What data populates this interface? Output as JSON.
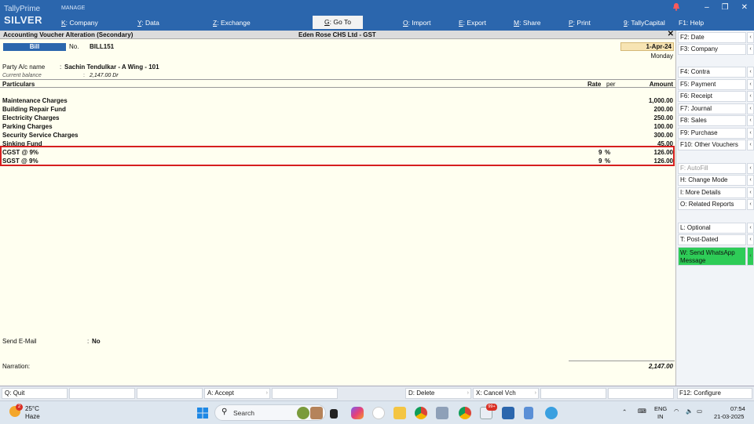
{
  "app": {
    "brand_line1": "TallyPrime",
    "brand_line2": "SILVER",
    "manage_label": "MANAGE"
  },
  "top_menu": [
    {
      "key": "K",
      "label": "Company"
    },
    {
      "key": "Y",
      "label": "Data"
    },
    {
      "key": "Z",
      "label": "Exchange"
    },
    {
      "key": "G",
      "label": "Go To"
    },
    {
      "key": "O",
      "label": "Import"
    },
    {
      "key": "E",
      "label": "Export"
    },
    {
      "key": "M",
      "label": "Share"
    },
    {
      "key": "P",
      "label": "Print"
    },
    {
      "key": "9",
      "label": "TallyCapital"
    },
    {
      "key": "F1",
      "label": "Help"
    }
  ],
  "title_bar": {
    "left": "Accounting Voucher Alteration (Secondary)",
    "center": "Eden Rose CHS Ltd - GST",
    "close_glyph": "✕"
  },
  "voucher": {
    "type_badge": "Bill",
    "no_label": "No.",
    "no_value": "BILL151",
    "date": "1-Apr-24",
    "day": "Monday",
    "party_label": "Party A/c name",
    "party_colon": ":",
    "party_value": "Sachin Tendulkar - A Wing - 101",
    "balance_label": "Current balance",
    "balance_colon": ":",
    "balance_value": "2,147.00 Dr"
  },
  "columns": {
    "particulars": "Particulars",
    "rate": "Rate",
    "per": "per",
    "amount": "Amount"
  },
  "entries": [
    {
      "name": "Maintenance Charges",
      "rate": "",
      "per": "",
      "amount": "1,000.00"
    },
    {
      "name": "Building Repair Fund",
      "rate": "",
      "per": "",
      "amount": "200.00"
    },
    {
      "name": "Electricity Charges",
      "rate": "",
      "per": "",
      "amount": "250.00"
    },
    {
      "name": "Parking Charges",
      "rate": "",
      "per": "",
      "amount": "100.00"
    },
    {
      "name": "Security Service Charges",
      "rate": "",
      "per": "",
      "amount": "300.00"
    },
    {
      "name": "Sinking Fund",
      "rate": "",
      "per": "",
      "amount": "45.00"
    },
    {
      "name": "CGST @ 9%",
      "rate": "9",
      "per": "%",
      "amount": "126.00"
    },
    {
      "name": "SGST @ 9%",
      "rate": "9",
      "per": "%",
      "amount": "126.00"
    }
  ],
  "footer": {
    "email_label": "Send E-Mail",
    "email_colon": ":",
    "email_value": "No",
    "narration_label": "Narration:",
    "total": "2,147.00"
  },
  "right_panel": [
    {
      "key": "F2",
      "label": "Date",
      "state": "enabled"
    },
    {
      "key": "F3",
      "label": "Company",
      "state": "enabled"
    },
    {
      "key": "F4",
      "label": "Contra",
      "state": "enabled"
    },
    {
      "key": "F5",
      "label": "Payment",
      "state": "enabled"
    },
    {
      "key": "F6",
      "label": "Receipt",
      "state": "enabled"
    },
    {
      "key": "F7",
      "label": "Journal",
      "state": "enabled"
    },
    {
      "key": "F8",
      "label": "Sales",
      "state": "enabled"
    },
    {
      "key": "F9",
      "label": "Purchase",
      "state": "enabled"
    },
    {
      "key": "F10",
      "label": "Other Vouchers",
      "state": "enabled"
    },
    {
      "key": "F",
      "label": "AutoFill",
      "state": "disabled"
    },
    {
      "key": "H",
      "label": "Change Mode",
      "state": "enabled"
    },
    {
      "key": "I",
      "label": "More Details",
      "state": "enabled"
    },
    {
      "key": "O",
      "label": "Related Reports",
      "state": "enabled"
    },
    {
      "key": "L",
      "label": "Optional",
      "state": "enabled"
    },
    {
      "key": "T",
      "label": "Post-Dated",
      "state": "enabled"
    },
    {
      "key": "W",
      "label": "Send WhatsApp Message",
      "state": "highlight"
    }
  ],
  "bottom_bar": [
    {
      "key": "Q",
      "label": "Quit"
    },
    {
      "key": "",
      "label": ""
    },
    {
      "key": "",
      "label": ""
    },
    {
      "key": "A",
      "label": "Accept"
    },
    {
      "key": "",
      "label": ""
    },
    {
      "key": "D",
      "label": "Delete"
    },
    {
      "key": "X",
      "label": "Cancel Vch"
    },
    {
      "key": "",
      "label": ""
    },
    {
      "key": "",
      "label": ""
    },
    {
      "key": "F12",
      "label": "Configure"
    }
  ],
  "taskbar": {
    "weather_badge": "2",
    "temperature": "25°C",
    "condition": "Haze",
    "search_placeholder": "Search",
    "lang_line1": "ENG",
    "lang_line2": "IN",
    "time": "07:54",
    "date": "21-03-2025",
    "mail_badge": "99+"
  },
  "colors": {
    "header_blue": "#2b66ad",
    "highlight_red": "#d61f1f",
    "whatsapp_green": "#2ecc57",
    "date_bg": "#f7e4b3"
  }
}
